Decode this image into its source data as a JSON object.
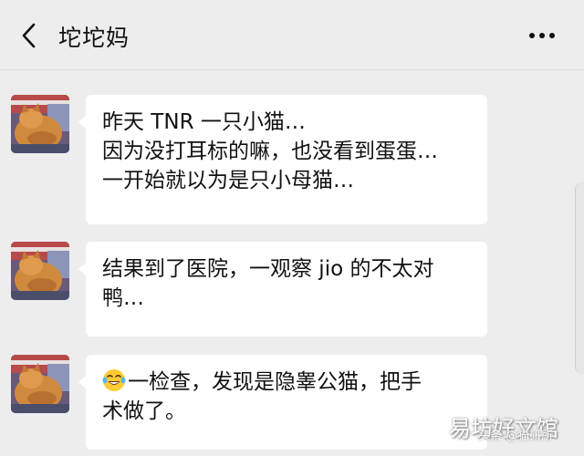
{
  "header": {
    "back_icon": "chevron-left-icon",
    "title": "坨坨妈",
    "more_icon": "more-dots-icon"
  },
  "messages": [
    {
      "sender_avatar": "cat-avatar",
      "lines": [
        "昨天 TNR 一只小猫…",
        "因为没打耳标的嘛，也没看到蛋蛋…",
        "一开始就以为是只小母猫…"
      ]
    },
    {
      "sender_avatar": "cat-avatar",
      "lines": [
        "结果到了医院，一观察 jio 的不太对",
        "鸭…"
      ]
    },
    {
      "sender_avatar": "cat-avatar",
      "emoji": "tears-of-joy-emoji",
      "lines": [
        "一检查，发现是隐睾公猫，把手",
        "术做了。"
      ]
    }
  ],
  "watermark": {
    "main": "易坊好文馆",
    "sub": "头条 @猫研所"
  }
}
